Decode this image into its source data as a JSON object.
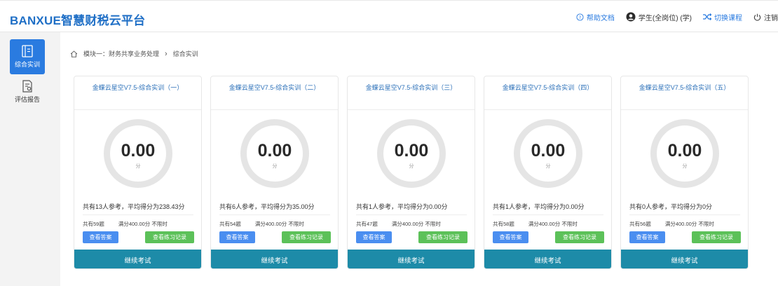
{
  "header": {
    "brand": "BANXUE智慧财税云平台",
    "help": "帮助文档",
    "user": "学生(全岗位) (学)",
    "switch_course": "切换课程",
    "logout": "注销"
  },
  "sidebar": {
    "items": [
      {
        "label": "综合实训",
        "icon": "document-icon",
        "active": true
      },
      {
        "label": "评估报告",
        "icon": "report-icon",
        "active": false
      }
    ]
  },
  "breadcrumb": {
    "module": "模块一：财务共享业务处理",
    "current": "综合实训"
  },
  "colors": {
    "brand": "#1f6fc6",
    "active_nav": "#2a7be0",
    "answer_button": "#4a8ef0",
    "record_button": "#5cc159",
    "continue_bar": "#1d8ba8"
  },
  "cards": [
    {
      "title": "金蝶云星空V7.5-综合实训（一）",
      "score": "0.00",
      "unit": "分",
      "summary": "共有13人参考，平均得分为238.43分",
      "questions": "共有59题",
      "full": "满分400.00分",
      "time": "不限时",
      "answer_btn": "查看答案",
      "record_btn": "查看练习记录",
      "continue": "继续考试"
    },
    {
      "title": "金蝶云星空V7.5-综合实训（二）",
      "score": "0.00",
      "unit": "分",
      "summary": "共有6人参考，平均得分为35.00分",
      "questions": "共有54题",
      "full": "满分400.00分",
      "time": "不限时",
      "answer_btn": "查看答案",
      "record_btn": "查看练习记录",
      "continue": "继续考试"
    },
    {
      "title": "金蝶云星空V7.5-综合实训（三）",
      "score": "0.00",
      "unit": "分",
      "summary": "共有1人参考，平均得分为0.00分",
      "questions": "共有47题",
      "full": "满分400.00分",
      "time": "不限时",
      "answer_btn": "查看答案",
      "record_btn": "查看练习记录",
      "continue": "继续考试"
    },
    {
      "title": "金蝶云星空V7.5-综合实训（四）",
      "score": "0.00",
      "unit": "分",
      "summary": "共有1人参考，平均得分为0.00分",
      "questions": "共有58题",
      "full": "满分400.00分",
      "time": "不限时",
      "answer_btn": "查看答案",
      "record_btn": "查看练习记录",
      "continue": "继续考试"
    },
    {
      "title": "金蝶云星空V7.5-综合实训（五）",
      "score": "0.00",
      "unit": "分",
      "summary": "共有0人参考，平均得分为0分",
      "questions": "共有56题",
      "full": "满分400.00分",
      "time": "不限时",
      "answer_btn": "查看答案",
      "record_btn": "查看练习记录",
      "continue": "继续考试"
    }
  ]
}
